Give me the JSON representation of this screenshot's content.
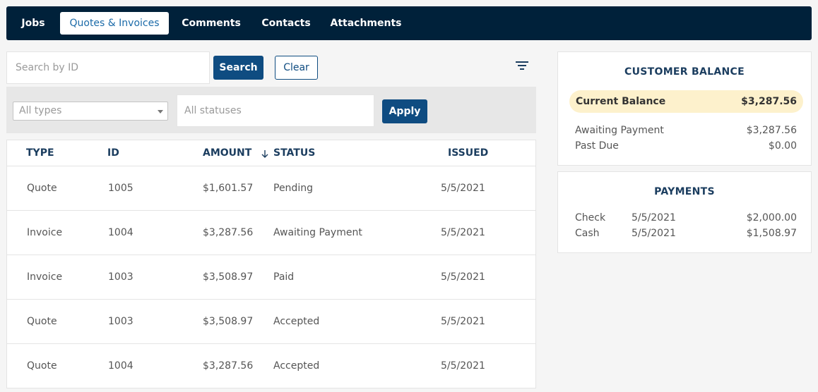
{
  "nav": {
    "tabs": [
      {
        "label": "Jobs"
      },
      {
        "label": "Quotes & Invoices"
      },
      {
        "label": "Comments"
      },
      {
        "label": "Contacts"
      },
      {
        "label": "Attachments"
      }
    ],
    "active_tab": "Quotes & Invoices"
  },
  "search": {
    "placeholder": "Search by ID",
    "value": "",
    "search_label": "Search",
    "clear_label": "Clear"
  },
  "filters": {
    "type_selected": "All types",
    "status_placeholder": "All statuses",
    "apply_label": "Apply"
  },
  "table": {
    "headers": {
      "type": "TYPE",
      "id": "ID",
      "amount": "AMOUNT",
      "status": "STATUS",
      "issued": "ISSUED"
    },
    "rows": [
      {
        "type": "Quote",
        "id": "1005",
        "amount": "$1,601.57",
        "status": "Pending",
        "issued": "5/5/2021"
      },
      {
        "type": "Invoice",
        "id": "1004",
        "amount": "$3,287.56",
        "status": "Awaiting Payment",
        "issued": "5/5/2021"
      },
      {
        "type": "Invoice",
        "id": "1003",
        "amount": "$3,508.97",
        "status": "Paid",
        "issued": "5/5/2021"
      },
      {
        "type": "Quote",
        "id": "1003",
        "amount": "$3,508.97",
        "status": "Accepted",
        "issued": "5/5/2021"
      },
      {
        "type": "Quote",
        "id": "1004",
        "amount": "$3,287.56",
        "status": "Accepted",
        "issued": "5/5/2021"
      }
    ]
  },
  "balance": {
    "title": "CUSTOMER BALANCE",
    "current_label": "Current Balance",
    "current_value": "$3,287.56",
    "awaiting_label": "Awaiting Payment",
    "awaiting_value": "$3,287.56",
    "pastdue_label": "Past Due",
    "pastdue_value": "$0.00"
  },
  "payments": {
    "title": "PAYMENTS",
    "items": [
      {
        "method": "Check",
        "date": "5/5/2021",
        "amount": "$2,000.00"
      },
      {
        "method": "Cash",
        "date": "5/5/2021",
        "amount": "$1,508.97"
      }
    ]
  },
  "colors": {
    "nav_bg": "#00213a",
    "primary": "#0f4c81",
    "active_tab_text": "#1a6aa8",
    "highlight": "#fdf1cc"
  },
  "icons": {
    "filter": "filter-lines-icon",
    "sort": "arrow-down-icon",
    "dropdown": "chevron-down-icon"
  }
}
